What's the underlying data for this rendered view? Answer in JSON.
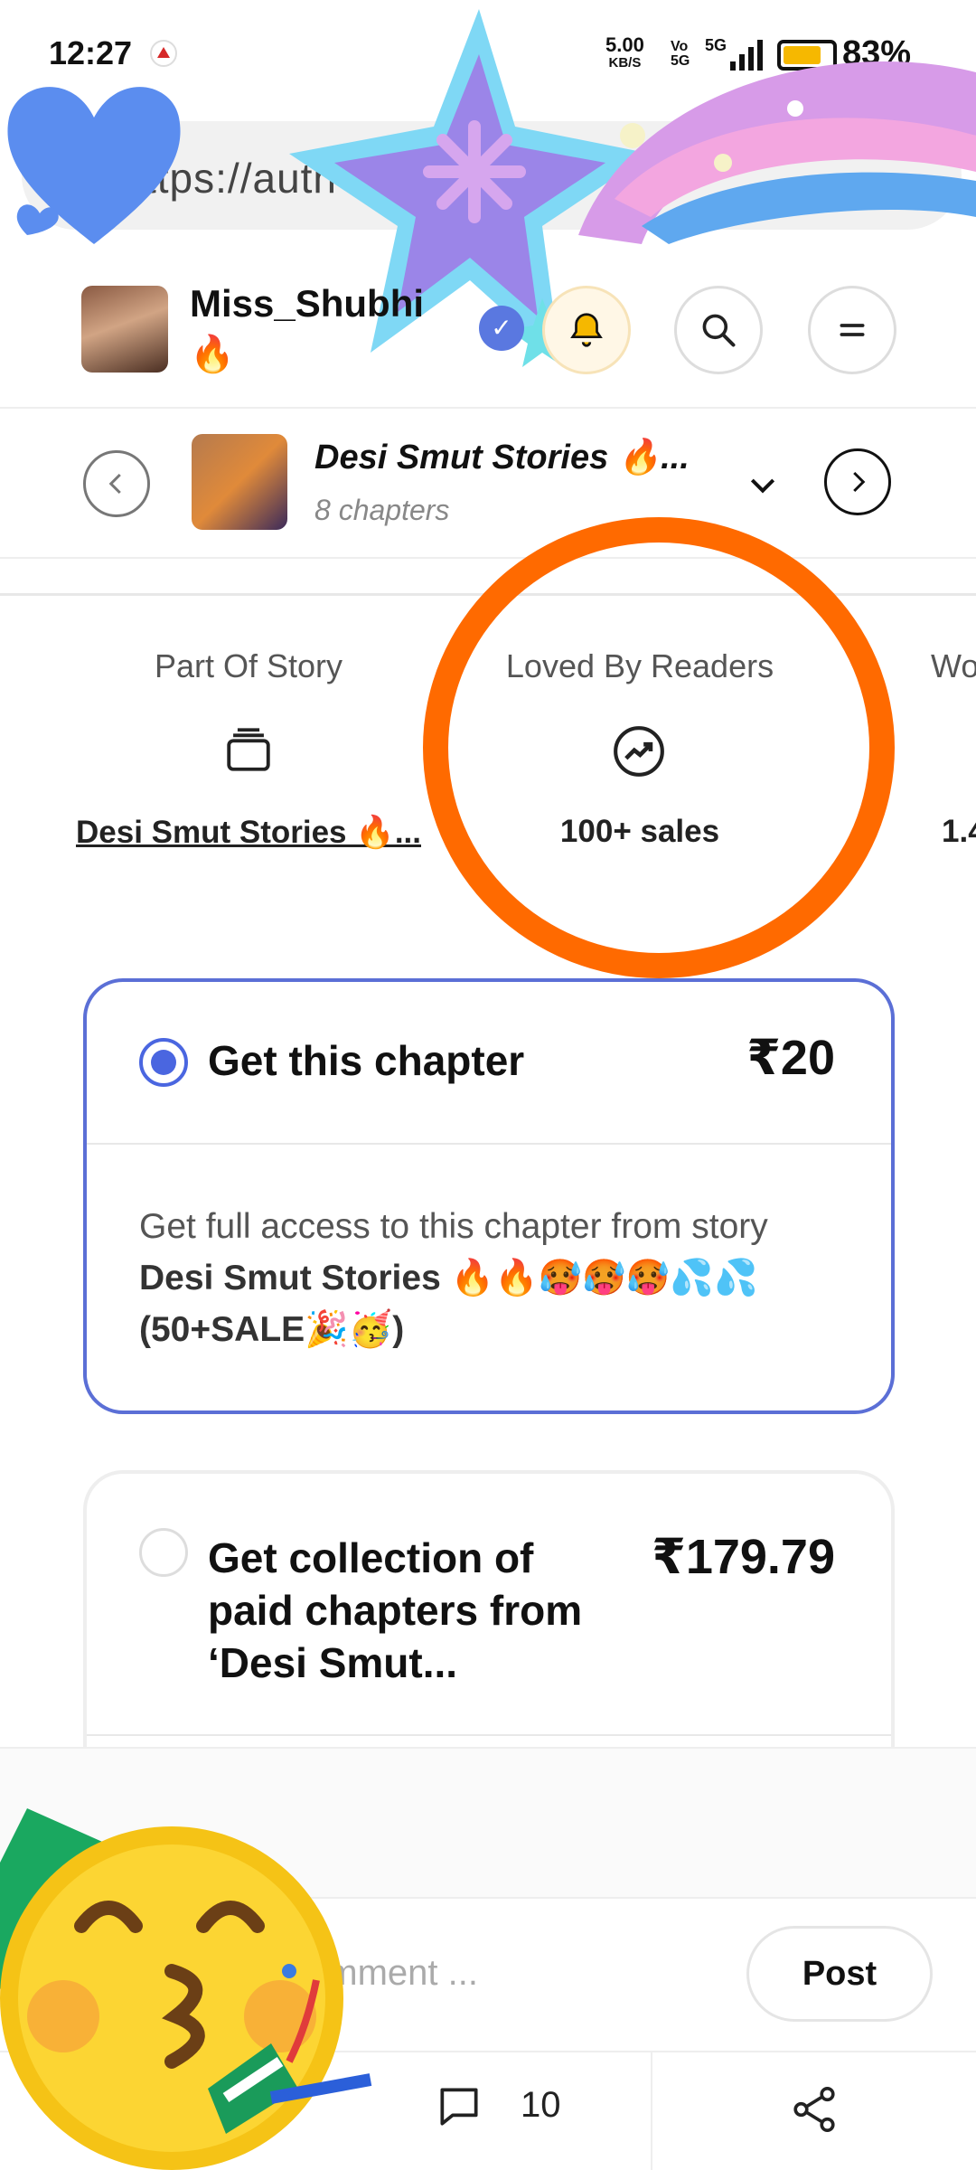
{
  "status_bar": {
    "time": "12:27",
    "net_speed": "5.00",
    "net_unit": "KB/S",
    "network": "5G",
    "battery": "83%"
  },
  "browser": {
    "url": "ttps://auth"
  },
  "header": {
    "author_name": "Miss_Shubhi",
    "author_emoji": "🔥",
    "icons": [
      "bell-icon",
      "search-icon",
      "menu-icon"
    ]
  },
  "story_nav": {
    "title": "Desi Smut Stories 🔥...",
    "chapters": "8 chapters"
  },
  "stats": [
    {
      "label": "Part Of Story",
      "value": "Desi Smut Stories 🔥...",
      "icon": "stack-icon"
    },
    {
      "label": "Loved By Readers",
      "value": "100+ sales",
      "icon": "trending-up-icon"
    },
    {
      "label": "Wo",
      "value": "1.4"
    }
  ],
  "purchase_options": [
    {
      "title": "Get this chapter",
      "price": "₹20",
      "selected": true,
      "desc_prefix": "Get full access to this chapter from story ",
      "desc_bold": "Desi Smut Stories 🔥🔥🥵🥵🥵💦💦(50+SALE🎉🥳)"
    },
    {
      "title": "Get collection of paid chapters from ‘Desi Smut...",
      "price": "₹179.79",
      "selected": false
    }
  ],
  "comment": {
    "placeholder": "omment ...",
    "post_label": "Post"
  },
  "bottom_bar": {
    "comment_count": "10",
    "icons": [
      "comment-icon",
      "share-icon"
    ]
  },
  "colors": {
    "accent": "#4a66e0",
    "highlight_ring": "#ff6a00"
  }
}
